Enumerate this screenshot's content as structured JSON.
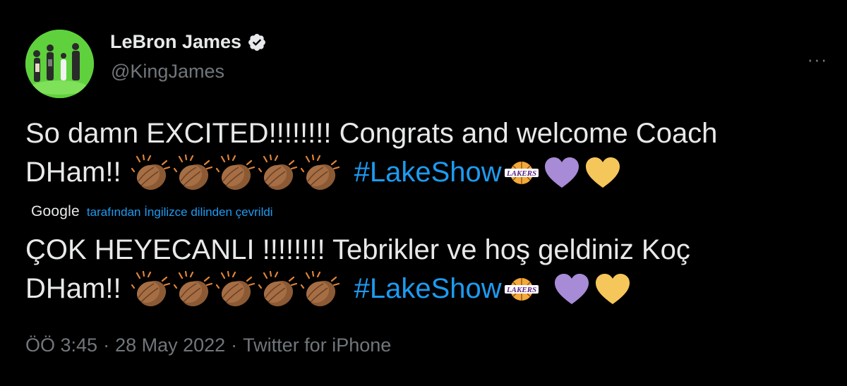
{
  "author": {
    "display_name": "LeBron James",
    "handle": "@KingJames",
    "verified": true
  },
  "tweet": {
    "original": {
      "line1": "So damn EXCITED!!!!!!!! Congrats and welcome Coach",
      "line2_text": "DHam!!",
      "hashtag": "#LakeShow"
    },
    "translation_label": {
      "provider": "Google",
      "note": "tarafından İngilizce dilinden çevrildi"
    },
    "translated": {
      "line1": "ÇOK HEYECANLI !!!!!!!! Tebrikler ve hoş geldiniz Koç",
      "line2_text": "DHam!!",
      "hashtag": "#LakeShow"
    },
    "emoji": [
      "clapping-hands-medium-dark",
      "clapping-hands-medium-dark",
      "clapping-hands-medium-dark",
      "clapping-hands-medium-dark",
      "clapping-hands-medium-dark",
      "lakers-logo",
      "purple-heart",
      "yellow-heart"
    ]
  },
  "meta": {
    "time": "ÖÖ 3:45",
    "date": "28 May 2022",
    "source": "Twitter for iPhone",
    "separator": "·"
  },
  "colors": {
    "background": "#000000",
    "text": "#e7e9ea",
    "muted": "#71767b",
    "link": "#1d9bf0",
    "purple_heart": "#a78bd6",
    "yellow_heart": "#f5c65a"
  }
}
